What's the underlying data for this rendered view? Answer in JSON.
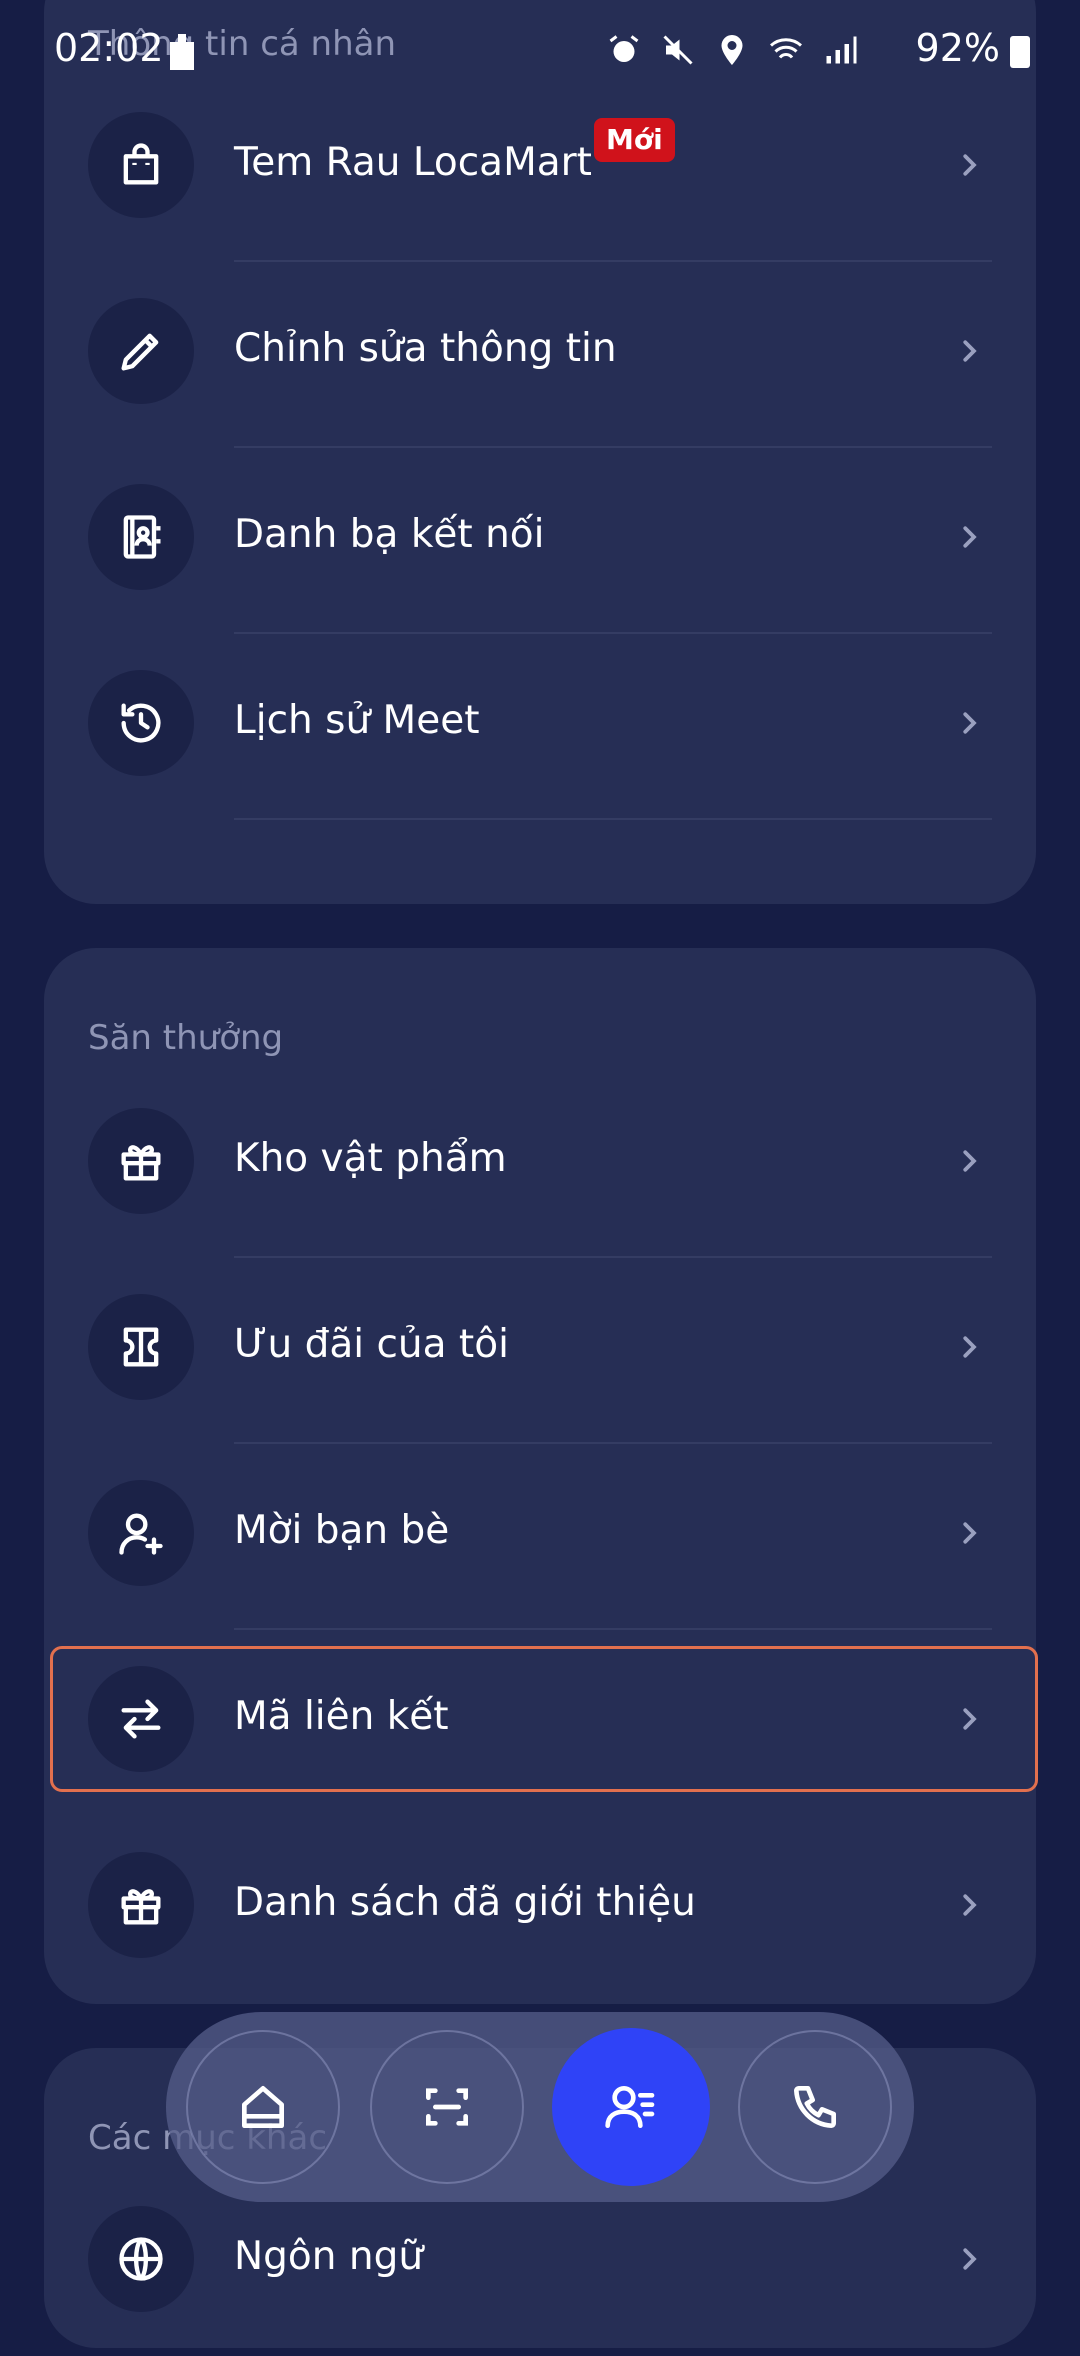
{
  "status_bar": {
    "time": "02:02",
    "battery_percent": "92%",
    "icons": [
      "alarm-icon",
      "mute-icon",
      "location-icon",
      "wifi-icon",
      "signal-icon",
      "battery-icon"
    ]
  },
  "sections": {
    "personal": {
      "label": "Thông tin cá nhân",
      "items": [
        {
          "label": "Tem Rau LocaMart",
          "icon": "bag-icon",
          "badge": "Mới"
        },
        {
          "label": "Chỉnh sửa thông tin",
          "icon": "pencil-icon"
        },
        {
          "label": "Danh bạ kết nối",
          "icon": "contacts-icon"
        },
        {
          "label": "Lịch sử Meet",
          "icon": "history-icon"
        }
      ]
    },
    "rewards": {
      "label": "Săn thưởng",
      "items": [
        {
          "label": "Kho vật phẩm",
          "icon": "gift-icon"
        },
        {
          "label": "Ưu đãi của tôi",
          "icon": "ticket-icon"
        },
        {
          "label": "Mời bạn bè",
          "icon": "add-user-icon"
        },
        {
          "label": "Mã liên kết",
          "icon": "swap-arrows-icon"
        },
        {
          "label": "Danh sách đã giới thiệu",
          "icon": "gift-icon"
        }
      ]
    },
    "other": {
      "label": "Các mục khác",
      "items": [
        {
          "label": "Ngôn ngữ",
          "icon": "globe-icon"
        }
      ]
    }
  },
  "bottom_nav": {
    "items": [
      "home-icon",
      "scan-icon",
      "profile-icon",
      "phone-icon"
    ],
    "active": "profile-icon"
  },
  "colors": {
    "background": "#161d45",
    "card": "#262e55",
    "highlight": "#e2704e",
    "badge": "#d0121b",
    "nav_active": "#2f43f7"
  }
}
